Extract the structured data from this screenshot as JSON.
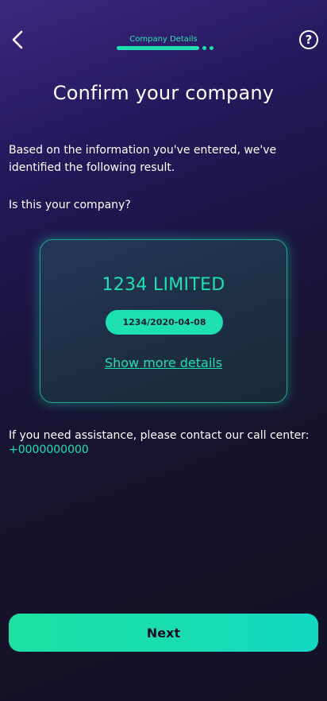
{
  "header": {
    "step_label": "Company Details",
    "help_glyph": "?"
  },
  "page": {
    "title": "Confirm your company",
    "intro": "Based on the information you've entered, we've identified the following result.",
    "question": "Is this your company?"
  },
  "company_card": {
    "name": "1234 LIMITED",
    "registration": "1234/2020-04-08",
    "more_details_link": "Show more details"
  },
  "assistance": {
    "text": "If you need assistance, please contact our call center:",
    "phone": "+0000000000"
  },
  "footer": {
    "next_label": "Next"
  },
  "icons": {
    "back": "chevron-left-icon",
    "help": "question-circle-icon"
  },
  "colors": {
    "accent": "#1fe0b0",
    "background_top": "#3b2780",
    "background_bottom": "#141227",
    "card_border": "#1fa88a"
  }
}
